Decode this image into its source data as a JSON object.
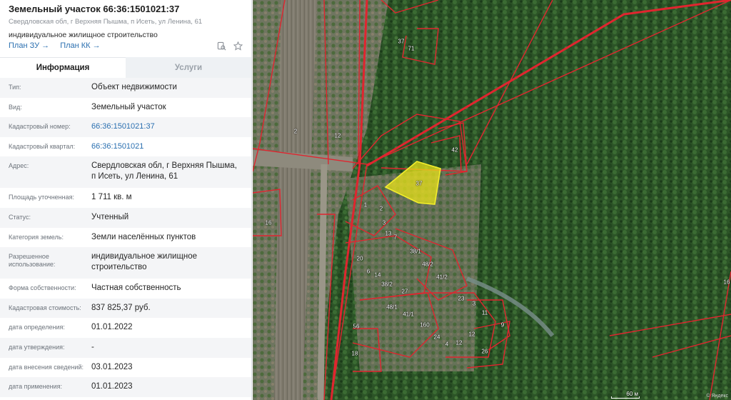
{
  "header": {
    "title": "Земельный участок 66:36:1501021:37",
    "address": "Свердловская обл, г Верхняя Пышма, п Исеть, ул Ленина, 61",
    "use": "индивидуальное жилищное строительство",
    "link_plan_zu": "План ЗУ →",
    "link_plan_kk": "План КК →",
    "icons": [
      "search-document-icon",
      "star-icon"
    ]
  },
  "tabs": {
    "info": "Информация",
    "services": "Услуги"
  },
  "rows": [
    {
      "label": "Тип:",
      "value": "Объект недвижимости"
    },
    {
      "label": "Вид:",
      "value": "Земельный участок"
    },
    {
      "label": "Кадастровый номер:",
      "value": "66:36:1501021:37"
    },
    {
      "label": "Кадастровый квартал:",
      "value": "66:36:1501021"
    },
    {
      "label": "Адрес:",
      "value": "Свердловская обл, г Верхняя Пышма, п Исеть, ул Ленина, 61"
    },
    {
      "label": "Площадь уточненная:",
      "value": "1 711 кв. м"
    },
    {
      "label": "Статус:",
      "value": "Учтенный"
    },
    {
      "label": "Категория земель:",
      "value": "Земли населённых пунктов"
    },
    {
      "label": "Разрешенное использование:",
      "value": "индивидуальное жилищное строительство"
    },
    {
      "label": "Форма собственности:",
      "value": "Частная собственность"
    },
    {
      "label": "Кадастровая стоимость:",
      "value": "837 825,37 руб."
    },
    {
      "label": "дата определения:",
      "value": "01.01.2022"
    },
    {
      "label": "дата утверждения:",
      "value": "-"
    },
    {
      "label": "дата внесения сведений:",
      "value": "03.01.2023"
    },
    {
      "label": "дата применения:",
      "value": "01.01.2023"
    }
  ],
  "map": {
    "parcel_labels": [
      "37",
      "37",
      "71",
      "2",
      "12",
      "42",
      "1",
      "2",
      "3",
      "13",
      "7",
      "20",
      "38/1",
      "48/2",
      "41/2",
      "6",
      "14",
      "38/2",
      "27",
      "23",
      "48/1",
      "41/1",
      "160",
      "3",
      "11",
      "9",
      "12",
      "24",
      "4",
      "12",
      "26",
      "56",
      "18",
      "16",
      "16"
    ],
    "scale_text": "60 м",
    "attribution": "© Яндекс",
    "colors": {
      "boundary": "#e0252f",
      "selected_fill": "#e8e21a",
      "forest": "#2f5a2a",
      "field": "#8a8f73"
    }
  }
}
